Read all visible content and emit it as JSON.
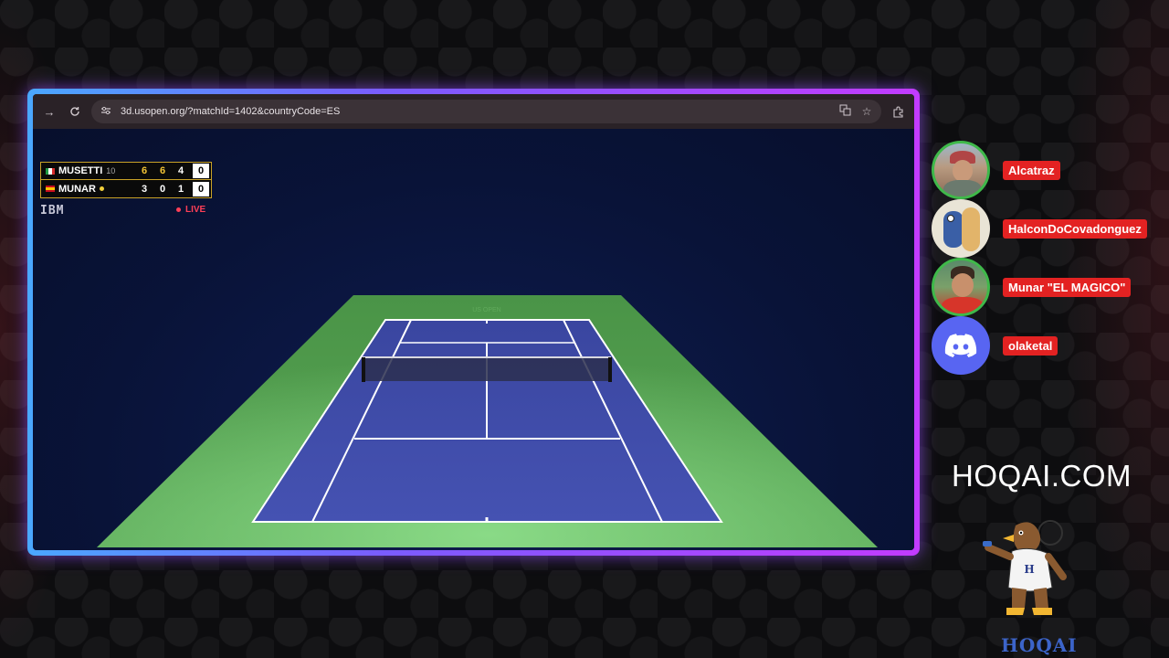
{
  "browser": {
    "url": "3d.usopen.org/?matchId=1402&countryCode=ES",
    "icons": [
      "forward-icon",
      "reload-icon",
      "site-info-icon",
      "translate-icon",
      "star-icon",
      "extensions-icon"
    ]
  },
  "scoreboard": {
    "players": [
      {
        "name": "MUSETTI",
        "seed": "10",
        "flag": "italy",
        "sets": [
          "6",
          "6",
          "4"
        ],
        "game": "0",
        "serving": false
      },
      {
        "name": "MUNAR",
        "seed": "",
        "flag": "spain",
        "sets": [
          "3",
          "0",
          "1"
        ],
        "game": "0",
        "serving": true
      }
    ],
    "sponsor": "IBM",
    "live_label": "LIVE"
  },
  "court": {
    "net_label": "US OPEN"
  },
  "viewers": [
    {
      "name": "Alcatraz",
      "avatar": "photo-avatar"
    },
    {
      "name": "HalconDoCovadonguez",
      "avatar": "cartoon-avatar"
    },
    {
      "name": "Munar \"EL MAGICO\"",
      "avatar": "player-avatar"
    },
    {
      "name": "olaketal",
      "avatar": "discord-icon"
    }
  ],
  "brand": {
    "site": "HOQAI.COM",
    "mascot_label": "HOQAI"
  },
  "colors": {
    "frame_gradient_start": "#4aa8ff",
    "frame_gradient_end": "#c23bff",
    "court_blue": "#3d4ba6",
    "court_green": "#4f9e4b",
    "name_tag_red": "#e32222",
    "avatar_ring": "#3fb94a",
    "discord_blurple": "#5865f2"
  }
}
